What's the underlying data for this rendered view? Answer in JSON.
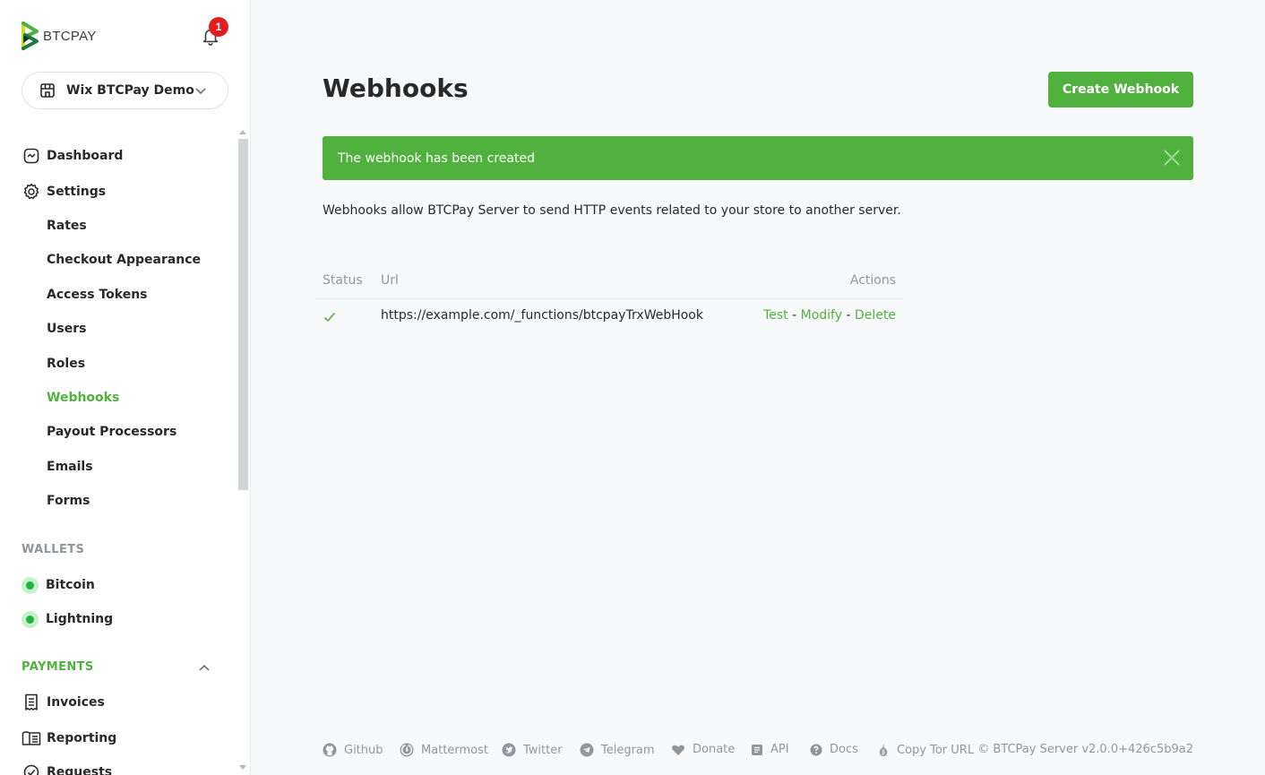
{
  "brand": {
    "name": "BTCPAY",
    "notification_count": "1",
    "accent": "#51b13e"
  },
  "store_selector": {
    "name": "Wix BTCPay Demo"
  },
  "sidebar": {
    "items": [
      {
        "label": "Dashboard",
        "icon": "dashboard-icon"
      },
      {
        "label": "Settings",
        "icon": "gear-icon"
      }
    ],
    "settings_sub": [
      {
        "label": "Rates",
        "active": false
      },
      {
        "label": "Checkout Appearance",
        "active": false
      },
      {
        "label": "Access Tokens",
        "active": false
      },
      {
        "label": "Users",
        "active": false
      },
      {
        "label": "Roles",
        "active": false
      },
      {
        "label": "Webhooks",
        "active": true
      },
      {
        "label": "Payout Processors",
        "active": false
      },
      {
        "label": "Emails",
        "active": false
      },
      {
        "label": "Forms",
        "active": false
      }
    ],
    "wallets_heading": "WALLETS",
    "wallets": [
      {
        "label": "Bitcoin",
        "status": "online"
      },
      {
        "label": "Lightning",
        "status": "online"
      }
    ],
    "payments_heading": "PAYMENTS",
    "payments": [
      {
        "label": "Invoices",
        "icon": "invoice-icon"
      },
      {
        "label": "Reporting",
        "icon": "reporting-icon"
      },
      {
        "label": "Requests",
        "icon": "requests-icon"
      }
    ]
  },
  "page": {
    "title": "Webhooks",
    "create_button": "Create Webhook",
    "alert": "The webhook has been created",
    "description": "Webhooks allow BTCPay Server to send HTTP events related to your store to another server."
  },
  "table": {
    "headers": {
      "status": "Status",
      "url": "Url",
      "actions": "Actions"
    },
    "rows": [
      {
        "status": "ok",
        "url": "https://example.com/_functions/btcpayTrxWebHook",
        "actions": {
          "test": "Test",
          "modify": "Modify",
          "delete": "Delete",
          "separator": "-"
        }
      }
    ]
  },
  "footer": {
    "links": [
      {
        "label": "Github",
        "icon": "github-icon"
      },
      {
        "label": "Mattermost",
        "icon": "mattermost-icon"
      },
      {
        "label": "Twitter",
        "icon": "twitter-icon"
      },
      {
        "label": "Telegram",
        "icon": "telegram-icon"
      },
      {
        "label": "Donate",
        "icon": "heart-icon"
      },
      {
        "label": "API",
        "icon": "api-icon"
      },
      {
        "label": "Docs",
        "icon": "question-icon"
      },
      {
        "label": "Copy Tor URL",
        "icon": "tor-icon"
      }
    ],
    "copyright": "© BTCPay Server v2.0.0+426c5b9a2"
  }
}
